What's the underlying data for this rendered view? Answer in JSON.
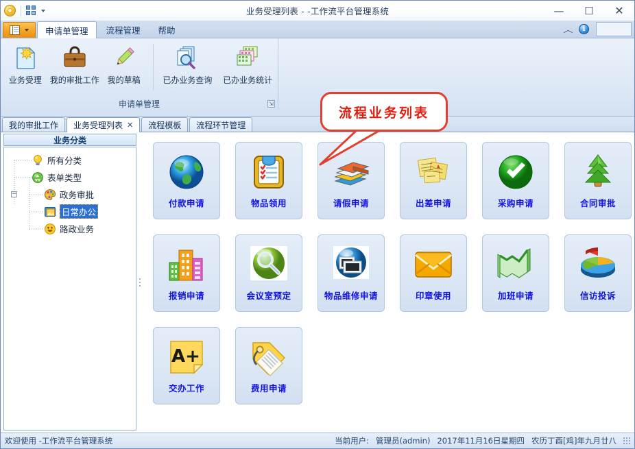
{
  "window": {
    "title": "业务受理列表 - -工作流平台管理系统",
    "minimize_label": "—",
    "maximize_label": "☐",
    "close_label": "✕",
    "quick_access": {
      "orb_icon": "app-orb-icon",
      "tiles_icon": "customize-quick-access-icon",
      "dropdown_icon": "chevron-down-icon"
    }
  },
  "ribbon": {
    "app_menu_label": "",
    "tabs": [
      {
        "label": "申请单管理",
        "active": true
      },
      {
        "label": "流程管理",
        "active": false
      },
      {
        "label": "帮助",
        "active": false
      }
    ],
    "right_tools": {
      "collapse_icon": "chevron-up-icon",
      "info_icon": "info-icon",
      "info_label": "i"
    },
    "group": {
      "title": "申请单管理",
      "dialog_launcher": "⇲",
      "items": [
        {
          "label": "业务受理",
          "icon": "new-document-icon"
        },
        {
          "label": "我的审批工作",
          "icon": "briefcase-icon"
        },
        {
          "label": "我的草稿",
          "icon": "pencil-icon"
        },
        {
          "label": "已办业务查询",
          "icon": "search-documents-icon"
        },
        {
          "label": "已办业务统计",
          "icon": "statistics-icon"
        }
      ]
    }
  },
  "callout": {
    "text": "流程业务列表",
    "border_color": "#e04030",
    "text_color": "#e01e10"
  },
  "doc_tabs": [
    {
      "label": "我的审批工作",
      "active": false,
      "closable": false
    },
    {
      "label": "业务受理列表",
      "active": true,
      "closable": true,
      "close_label": "✕"
    },
    {
      "label": "流程模板",
      "active": false,
      "closable": false
    },
    {
      "label": "流程环节管理",
      "active": false,
      "closable": false
    }
  ],
  "sidebar": {
    "header": "业务分类",
    "tree": [
      {
        "label": "所有分类",
        "icon": "lightbulb-icon",
        "level": 1,
        "selected": false,
        "expander": ""
      },
      {
        "label": "表单类型",
        "icon": "recycle-icon",
        "level": 1,
        "selected": false,
        "expander": "−"
      },
      {
        "label": "政务审批",
        "icon": "palette-icon",
        "level": 2,
        "selected": false,
        "expander": ""
      },
      {
        "label": "日常办公",
        "icon": "window-image-icon",
        "level": 2,
        "selected": true,
        "expander": ""
      },
      {
        "label": "路政业务",
        "icon": "smiley-icon",
        "level": 2,
        "selected": false,
        "expander": ""
      }
    ]
  },
  "content": {
    "tiles": [
      {
        "label": "付款申请",
        "icon": "globe-icon"
      },
      {
        "label": "物品领用",
        "icon": "clipboard-checklist-icon"
      },
      {
        "label": "请假申请",
        "icon": "books-icon"
      },
      {
        "label": "出差申请",
        "icon": "sticky-notes-icon"
      },
      {
        "label": "采购申请",
        "icon": "green-check-icon"
      },
      {
        "label": "合同审批",
        "icon": "tree-icon"
      },
      {
        "label": "报销申请",
        "icon": "buildings-icon"
      },
      {
        "label": "会议室预定",
        "icon": "magnifier-globe-icon"
      },
      {
        "label": "物品维修申请",
        "icon": "photos-globe-icon"
      },
      {
        "label": "印章使用",
        "icon": "envelope-icon"
      },
      {
        "label": "加班申请",
        "icon": "area-chart-icon"
      },
      {
        "label": "信访投诉",
        "icon": "pie-chart-icon"
      },
      {
        "label": "交办工作",
        "icon": "a-plus-note-icon"
      },
      {
        "label": "费用申请",
        "icon": "price-tag-icon"
      }
    ],
    "tile_label_color": "#1414e0"
  },
  "status": {
    "left": "欢迎使用 -工作流平台管理系统",
    "user_label": "当前用户:",
    "user_value": "管理员(admin)",
    "date": "2017年11月16日星期四",
    "lunar": "农历丁酉[鸡]年九月廿八"
  }
}
